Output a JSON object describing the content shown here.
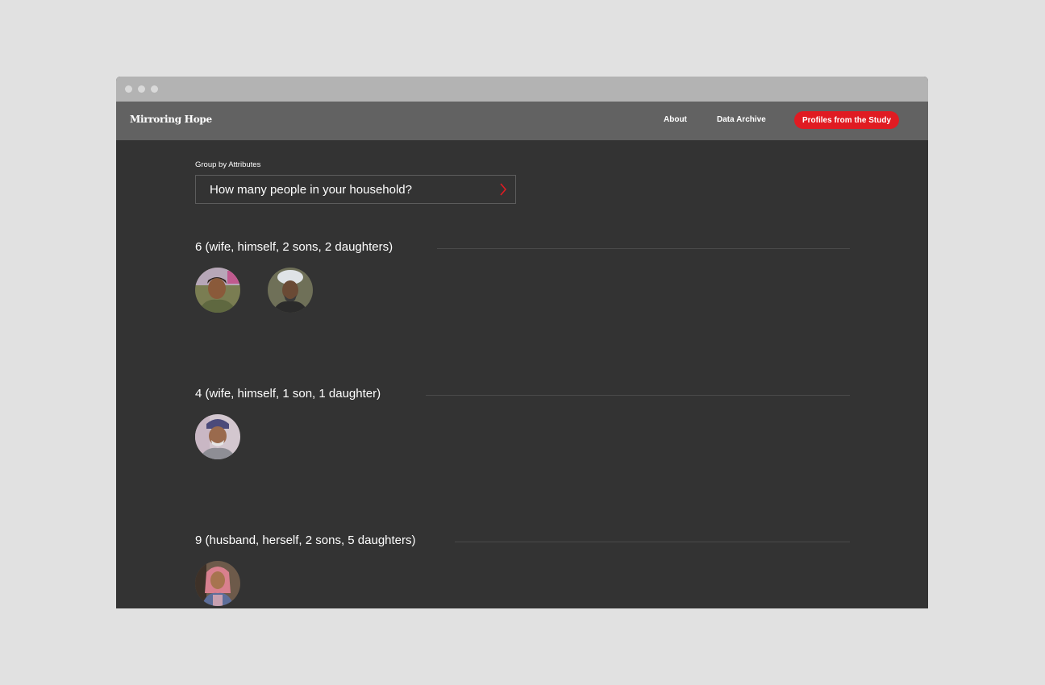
{
  "nav": {
    "logo": "Mirroring Hope",
    "links": [
      "About",
      "Data Archive"
    ],
    "cta": "Profiles from the Study"
  },
  "filter": {
    "label": "Group by Attributes",
    "selected": "How many people in your household?"
  },
  "groups": [
    {
      "title": "6 (wife, himself, 2 sons, 2 daughters)",
      "avatars": 2
    },
    {
      "title": "4 (wife, himself, 1 son, 1 daughter)",
      "avatars": 1
    },
    {
      "title": "9 (husband, herself, 2 sons, 5 daughters)",
      "avatars": 1
    }
  ],
  "colors": {
    "accent": "#e01b22",
    "page_bg": "#333333",
    "navbar_bg": "#626262",
    "outer_bg": "#e1e1e1"
  },
  "icons": {
    "select_chevron": "chevron-right-icon"
  }
}
